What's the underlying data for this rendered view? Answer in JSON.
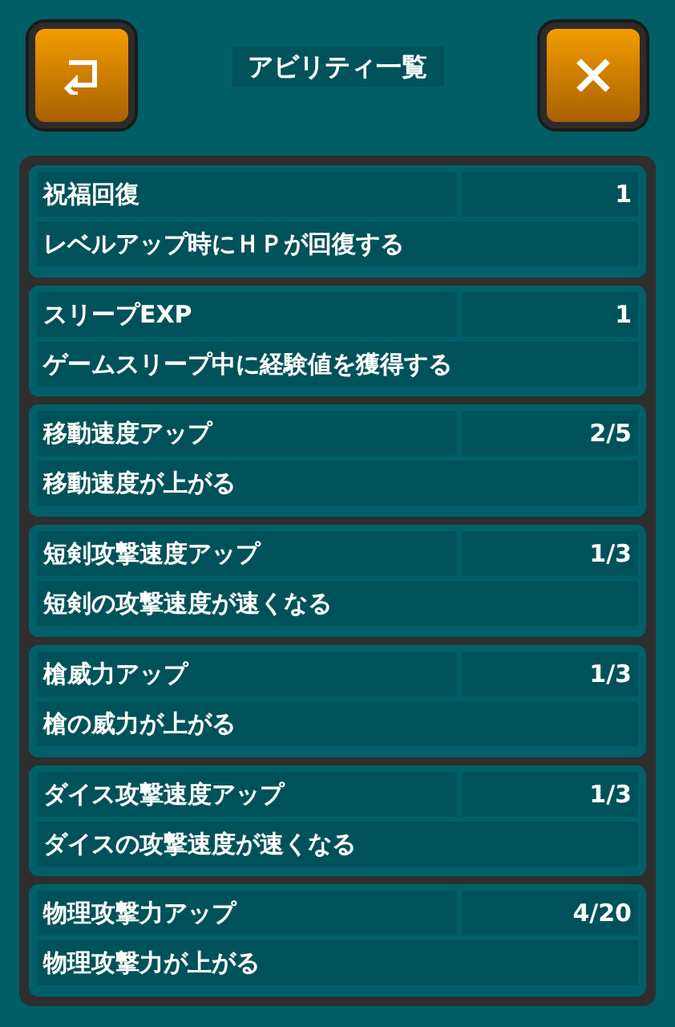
{
  "header": {
    "title": "アビリティ一覧"
  },
  "abilities": [
    {
      "name": "祝福回復",
      "level": "1",
      "description": "レベルアップ時にＨＰが回復する"
    },
    {
      "name": "スリープEXP",
      "level": "1",
      "description": "ゲームスリープ中に経験値を獲得する"
    },
    {
      "name": "移動速度アップ",
      "level": "2/5",
      "description": "移動速度が上がる"
    },
    {
      "name": "短剣攻撃速度アップ",
      "level": "1/3",
      "description": "短剣の攻撃速度が速くなる"
    },
    {
      "name": "槍威力アップ",
      "level": "1/3",
      "description": "槍の威力が上がる"
    },
    {
      "name": "ダイス攻撃速度アップ",
      "level": "1/3",
      "description": "ダイスの攻撃速度が速くなる"
    },
    {
      "name": "物理攻撃力アップ",
      "level": "4/20",
      "description": "物理攻撃力が上がる"
    }
  ]
}
